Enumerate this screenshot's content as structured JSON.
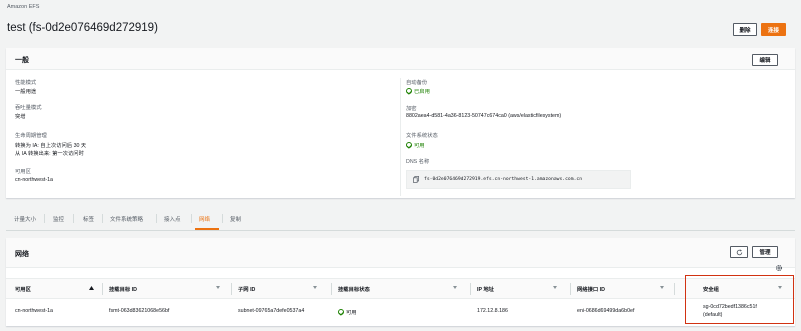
{
  "breadcrumb": "Amazon EFS",
  "title": "test (fs-0d2e076469d272919)",
  "header_buttons": {
    "delete": "删除",
    "attach": "连接"
  },
  "general": {
    "heading": "一般",
    "edit": "编辑",
    "performance_mode_label": "性能模式",
    "performance_mode": "一般用途",
    "throughput_mode_label": "吞吐量模式",
    "throughput_mode": "突增",
    "lifecycle_label": "生命周期管理",
    "lifecycle_line1": "转换为 IA: 自上次访问后 30 天",
    "lifecycle_line2": "从 IA 转换出来: 第一次访问时",
    "az_label": "可用区",
    "az": "cn-northwest-1a",
    "backup_label": "自动备份",
    "backup": "已启用",
    "encryption_label": "加密",
    "encryption": "8802aea4-d581-4a36-8123-50747c674ca0 (aws/elasticfilesystem)",
    "state_label": "文件系统状态",
    "state": "可用",
    "dns_label": "DNS 名称",
    "dns": "fs-0d2e076469d272919.efs.cn-northwest-1.amazonaws.com.cn"
  },
  "tabs": [
    "计量大小",
    "监控",
    "标签",
    "文件系统策略",
    "接入点",
    "网络",
    "复制"
  ],
  "active_tab_index": 5,
  "network": {
    "heading": "网络",
    "manage": "管理",
    "columns": [
      "可用区",
      "挂载目标 ID",
      "子网 ID",
      "挂载目标状态",
      "IP 地址",
      "网络接口 ID",
      "安全组"
    ],
    "row": {
      "az": "cn-northwest-1a",
      "mount_target_id": "fsmt-063d83621068e56bf",
      "subnet_id": "subnet-09765a7defe0537a4",
      "status": "可用",
      "ip": "172.12.8.186",
      "eni": "eni-0686d69499da6b0ef",
      "sg_line1": "sg-0cd72bedf1386c51f",
      "sg_line2": "(default)"
    }
  },
  "colors": {
    "accent": "#ec7211",
    "ok": "#1d8102",
    "highlight": "#d13212"
  },
  "icons": [
    "copy-icon",
    "refresh-icon",
    "settings-gear-icon",
    "sort-up-icon",
    "sort-down-icon",
    "status-ok-icon"
  ]
}
